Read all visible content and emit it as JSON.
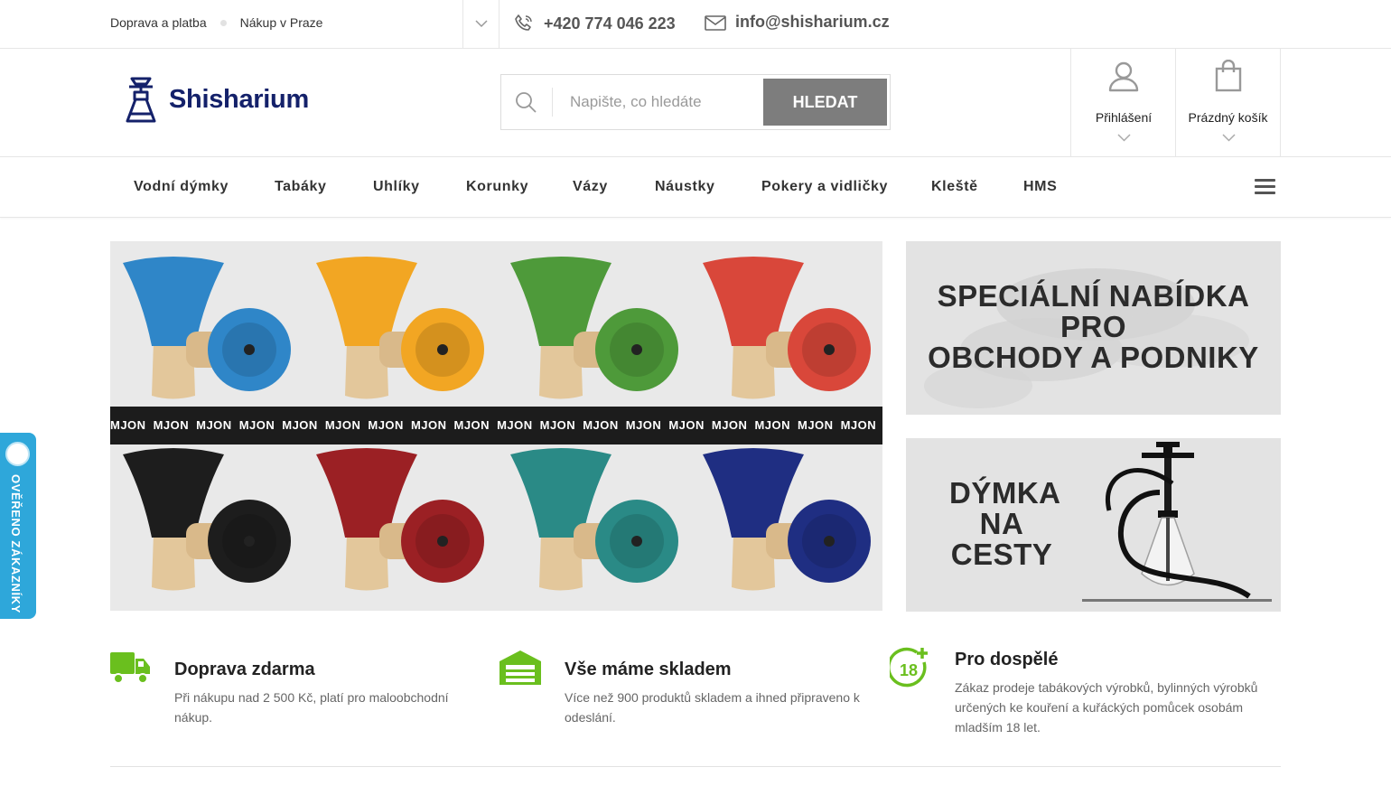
{
  "topbar": {
    "links": [
      "Doprava a platba",
      "Nákup v Praze"
    ],
    "phone": "+420 774 046 223",
    "email": "info@shisharium.cz"
  },
  "header": {
    "logo_text": "Shisharium",
    "search_placeholder": "Napište, co hledáte",
    "search_button": "HLEDAT",
    "login_label": "Přihlášení",
    "cart_label": "Prázdný košík"
  },
  "nav": {
    "items": [
      "Vodní dýmky",
      "Tabáky",
      "Uhlíky",
      "Korunky",
      "Vázy",
      "Náustky",
      "Pokery a vidličky",
      "Kleště",
      "HMS"
    ]
  },
  "banners": {
    "hero_strip_word": "MJON",
    "side1_lines": [
      "SPECIÁLNÍ NABÍDKA",
      "PRO",
      "OBCHODY A PODNIKY"
    ],
    "side2_lines": [
      "DÝMKA",
      "NA",
      "CESTY"
    ],
    "bowl_colors": [
      "#2f86c8",
      "#f2a623",
      "#4e9a3a",
      "#d9473a",
      "#1d1d1d",
      "#9b2024",
      "#2a8a86",
      "#1f2e82"
    ]
  },
  "badge": {
    "text": "OVĚŘENO ZÁKAZNÍKY"
  },
  "features": [
    {
      "icon": "truck-icon",
      "title": "Doprava zdarma",
      "desc": "Při nákupu nad 2 500 Kč, platí pro maloobchodní nákup."
    },
    {
      "icon": "warehouse-icon",
      "title": "Vše máme skladem",
      "desc": "Více než 900 produktů skladem a ihned připraveno k odeslání."
    },
    {
      "icon": "age-18-icon",
      "title": "Pro dospělé",
      "desc": "Zákaz prodeje tabákových výrobků, bylinných výrobků určených ke kouření a kuřáckých pomůcek osobám mladším 18 let."
    }
  ],
  "colors": {
    "brand": "#14216a",
    "accent_green": "#6abf1e",
    "badge_blue": "#2ea7da",
    "button_gray": "#7d7d7d"
  }
}
